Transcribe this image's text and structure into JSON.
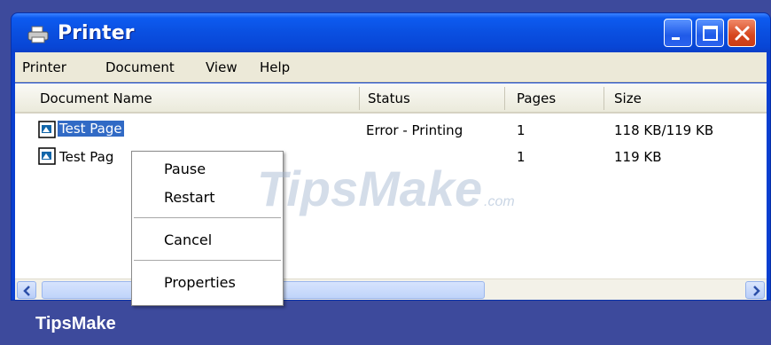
{
  "window": {
    "title": "Printer",
    "controls": [
      "minimize-icon",
      "maximize-icon",
      "close-icon"
    ]
  },
  "menubar": {
    "items": [
      "Printer",
      "Document",
      "View",
      "Help"
    ]
  },
  "columns": [
    "Document Name",
    "Status",
    "Pages",
    "Size"
  ],
  "rows": [
    {
      "name": "Test Page",
      "status": "Error - Printing",
      "pages": "1",
      "size": "118 KB/119 KB",
      "selected": true
    },
    {
      "name": "Test Pag",
      "status": "",
      "pages": "1",
      "size": "119 KB",
      "selected": false
    }
  ],
  "context_menu": {
    "items": [
      "Pause",
      "Restart",
      "Cancel",
      "Properties"
    ]
  },
  "footer": {
    "brand": "TipsMake"
  },
  "watermark": {
    "text": "TipsMake",
    "suffix": ".com"
  },
  "colors": {
    "titlebar": "#0a4fe0",
    "selection": "#316ac5",
    "close_button": "#d6461e",
    "background": "#3d4a9c"
  }
}
